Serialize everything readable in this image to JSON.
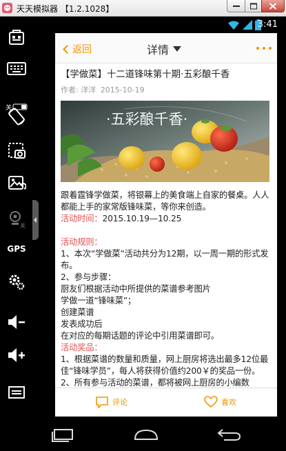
{
  "window": {
    "title": "天天模拟器 【1.2.1028】",
    "controls": [
      "minimize",
      "maximize",
      "close"
    ]
  },
  "toolbar": {
    "tools": [
      {
        "icon": "app-store-icon"
      },
      {
        "icon": "keyboard-icon",
        "badge": "关"
      },
      {
        "icon": "rotate-screen-icon"
      },
      {
        "icon": "screenshot-icon"
      },
      {
        "icon": "gallery-icon"
      },
      {
        "icon": "camera-off-icon",
        "badge": "关"
      },
      {
        "icon": "gps-icon",
        "label": "GPS"
      },
      {
        "icon": "settings-icon"
      },
      {
        "icon": "volume-down-icon"
      },
      {
        "icon": "volume-up-icon"
      },
      {
        "icon": "menu-icon"
      }
    ]
  },
  "statusbar": {
    "time": "3:41"
  },
  "header": {
    "back_label": "返回",
    "title": "详情"
  },
  "article": {
    "title": "【学做菜】十二道锋味第十期·五彩酿千香",
    "author_label": "作者:",
    "author": "洋洋",
    "date": "2015-10-19",
    "hero_caption": "·五彩酿千香·",
    "intro": "跟着霆锋学做菜，将银幕上的美食端上自家的餐桌。人人都能上手的家常版锋味菜，等你来创造。",
    "time_label": "活动时间：",
    "time_value": "2015.10.19—10.25",
    "rules_label": "活动规则：",
    "rules_lines": [
      "1、本次“学做菜”活动共分为12期，以一周一期的形式发布。",
      "2、参与步骤：",
      "厨友们根据活动中所提供的菜谱参考图片",
      "学做一道“锋味菜”；",
      "创建菜谱",
      "发表成功后",
      "在对应的每期话题的评论中引用菜谱即可。"
    ],
    "prizes_label": "活动奖品：",
    "prizes_lines": [
      "1、根据菜谱的数量和质量，网上厨房将选出最多12位最佳“锋味学员”，每人将获得价值约200￥的奖品一份。",
      "2、所有参与活动的菜谱，都将被网上厨房的小编数"
    ]
  },
  "bottom_bar": {
    "comment_label": "评论",
    "like_label": "喜欢"
  },
  "colors": {
    "accent": "#f29400",
    "highlight": "#e84f4f"
  }
}
